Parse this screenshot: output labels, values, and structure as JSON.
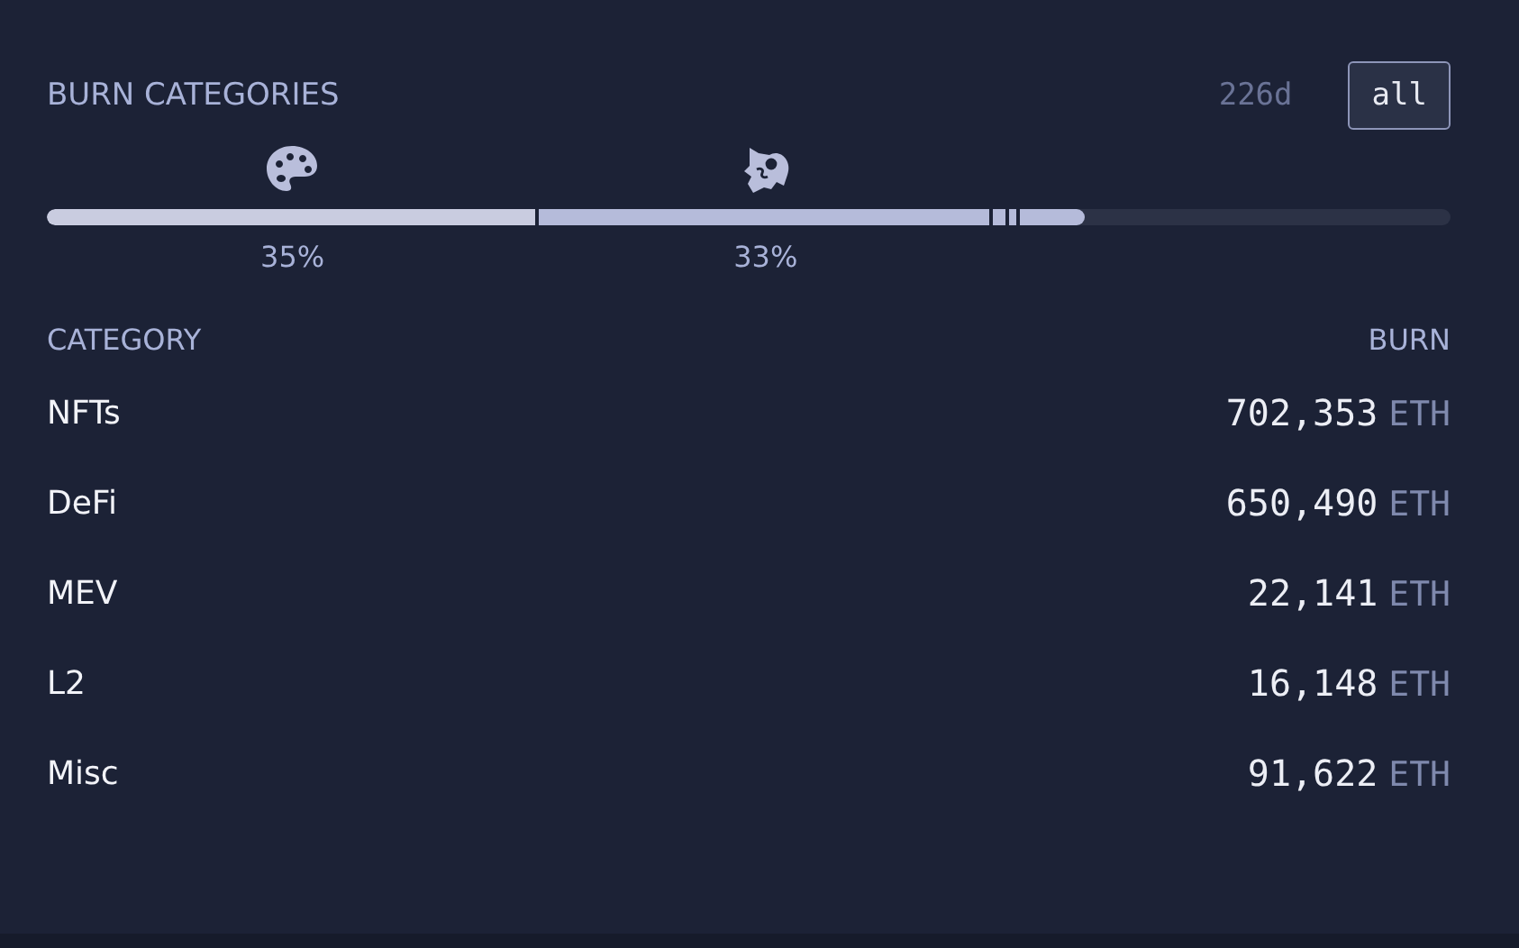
{
  "title": "BURN CATEGORIES",
  "period": {
    "label": "226d",
    "selected": false
  },
  "period_all": {
    "label": "all",
    "selected": true
  },
  "bar": {
    "labels": [
      "35%",
      "33%"
    ]
  },
  "table": {
    "columns": [
      "CATEGORY",
      "BURN"
    ],
    "rows": [
      {
        "category": "NFTs",
        "burn": "702,353",
        "unit": "ETH"
      },
      {
        "category": "DeFi",
        "burn": "650,490",
        "unit": "ETH"
      },
      {
        "category": "MEV",
        "burn": "22,141",
        "unit": "ETH"
      },
      {
        "category": "L2",
        "burn": "16,148",
        "unit": "ETH"
      },
      {
        "category": "Misc",
        "burn": "91,622",
        "unit": "ETH"
      }
    ]
  }
}
